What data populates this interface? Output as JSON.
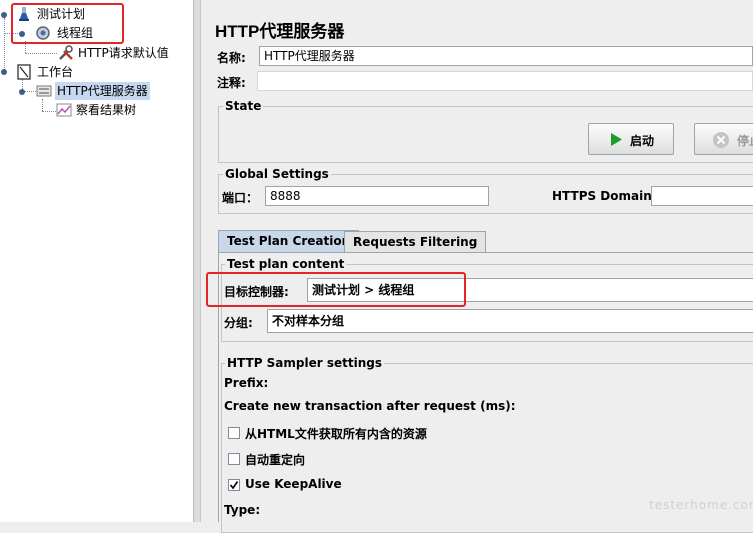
{
  "tree": {
    "items": [
      {
        "label": "测试计划",
        "icon": "test-plan-icon"
      },
      {
        "label": "线程组",
        "icon": "thread-group-icon"
      },
      {
        "label": "HTTP请求默认值",
        "icon": "wrench-icon"
      },
      {
        "label": "工作台",
        "icon": "workbench-icon"
      },
      {
        "label": "HTTP代理服务器",
        "icon": "proxy-server-icon"
      },
      {
        "label": "察看结果树",
        "icon": "results-tree-icon"
      }
    ]
  },
  "main": {
    "title": "HTTP代理服务器",
    "name_label": "名称:",
    "name_value": "HTTP代理服务器",
    "comment_label": "注释:",
    "comment_value": "",
    "state_legend": "State",
    "start_label": "启动",
    "stop_label": "停止",
    "global_legend": "Global Settings",
    "port_label": "端口：",
    "port_value": "8888",
    "https_label": "HTTPS Domains:",
    "https_value": "",
    "tabs": [
      {
        "label": "Test Plan Creation",
        "active": true
      },
      {
        "label": "Requests Filtering",
        "active": false
      }
    ],
    "content_legend": "Test plan content",
    "target_label": "目标控制器:",
    "target_value": "测试计划 > 线程组",
    "group_label": "分组:",
    "group_value": "不对样本分组",
    "sampler_legend": "HTTP Sampler settings",
    "prefix_label": "Prefix:",
    "transaction_label": "Create new transaction after request (ms):",
    "checkboxes": [
      {
        "label": "从HTML文件获取所有内含的资源",
        "checked": false
      },
      {
        "label": "自动重定向",
        "checked": false
      },
      {
        "label": "Use KeepAlive",
        "checked": true
      }
    ],
    "type_label": "Type:"
  },
  "colors": {
    "highlight": "#e0262a",
    "selection": "#c6d8f0",
    "start_icon": "#1e9b2c"
  },
  "watermark": "testerhome.com"
}
